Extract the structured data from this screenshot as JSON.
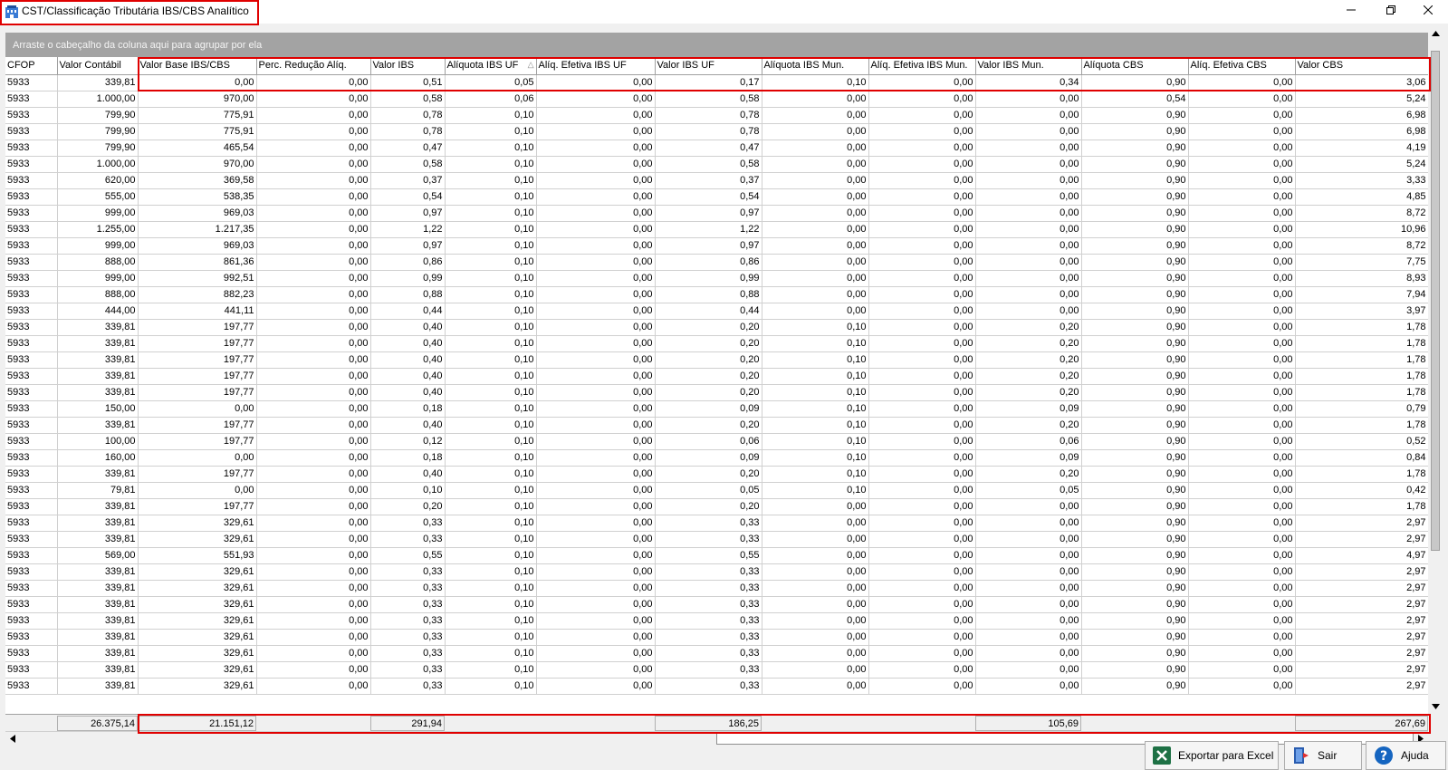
{
  "window": {
    "title": "CST/Classificação Tributária IBS/CBS Analítico"
  },
  "grid": {
    "group_hint": "Arraste o cabeçalho da coluna aqui para agrupar por ela",
    "sort_indicator": "△",
    "columns": [
      "CFOP",
      "Valor Contábil",
      "Valor Base IBS/CBS",
      "Perc. Redução Alíq.",
      "Valor IBS",
      "Alíquota IBS UF",
      "Alíq. Efetiva IBS UF",
      "Valor IBS UF",
      "Alíquota IBS Mun.",
      "Alíq. Efetiva IBS Mun.",
      "Valor IBS Mun.",
      "Alíquota CBS",
      "Alíq. Efetiva CBS",
      "Valor CBS"
    ],
    "rows": [
      [
        "5933",
        "339,81",
        "0,00",
        "0,00",
        "0,51",
        "0,05",
        "0,00",
        "0,17",
        "0,10",
        "0,00",
        "0,34",
        "0,90",
        "0,00",
        "3,06"
      ],
      [
        "5933",
        "1.000,00",
        "970,00",
        "0,00",
        "0,58",
        "0,06",
        "0,00",
        "0,58",
        "0,00",
        "0,00",
        "0,00",
        "0,54",
        "0,00",
        "5,24"
      ],
      [
        "5933",
        "799,90",
        "775,91",
        "0,00",
        "0,78",
        "0,10",
        "0,00",
        "0,78",
        "0,00",
        "0,00",
        "0,00",
        "0,90",
        "0,00",
        "6,98"
      ],
      [
        "5933",
        "799,90",
        "775,91",
        "0,00",
        "0,78",
        "0,10",
        "0,00",
        "0,78",
        "0,00",
        "0,00",
        "0,00",
        "0,90",
        "0,00",
        "6,98"
      ],
      [
        "5933",
        "799,90",
        "465,54",
        "0,00",
        "0,47",
        "0,10",
        "0,00",
        "0,47",
        "0,00",
        "0,00",
        "0,00",
        "0,90",
        "0,00",
        "4,19"
      ],
      [
        "5933",
        "1.000,00",
        "970,00",
        "0,00",
        "0,58",
        "0,10",
        "0,00",
        "0,58",
        "0,00",
        "0,00",
        "0,00",
        "0,90",
        "0,00",
        "5,24"
      ],
      [
        "5933",
        "620,00",
        "369,58",
        "0,00",
        "0,37",
        "0,10",
        "0,00",
        "0,37",
        "0,00",
        "0,00",
        "0,00",
        "0,90",
        "0,00",
        "3,33"
      ],
      [
        "5933",
        "555,00",
        "538,35",
        "0,00",
        "0,54",
        "0,10",
        "0,00",
        "0,54",
        "0,00",
        "0,00",
        "0,00",
        "0,90",
        "0,00",
        "4,85"
      ],
      [
        "5933",
        "999,00",
        "969,03",
        "0,00",
        "0,97",
        "0,10",
        "0,00",
        "0,97",
        "0,00",
        "0,00",
        "0,00",
        "0,90",
        "0,00",
        "8,72"
      ],
      [
        "5933",
        "1.255,00",
        "1.217,35",
        "0,00",
        "1,22",
        "0,10",
        "0,00",
        "1,22",
        "0,00",
        "0,00",
        "0,00",
        "0,90",
        "0,00",
        "10,96"
      ],
      [
        "5933",
        "999,00",
        "969,03",
        "0,00",
        "0,97",
        "0,10",
        "0,00",
        "0,97",
        "0,00",
        "0,00",
        "0,00",
        "0,90",
        "0,00",
        "8,72"
      ],
      [
        "5933",
        "888,00",
        "861,36",
        "0,00",
        "0,86",
        "0,10",
        "0,00",
        "0,86",
        "0,00",
        "0,00",
        "0,00",
        "0,90",
        "0,00",
        "7,75"
      ],
      [
        "5933",
        "999,00",
        "992,51",
        "0,00",
        "0,99",
        "0,10",
        "0,00",
        "0,99",
        "0,00",
        "0,00",
        "0,00",
        "0,90",
        "0,00",
        "8,93"
      ],
      [
        "5933",
        "888,00",
        "882,23",
        "0,00",
        "0,88",
        "0,10",
        "0,00",
        "0,88",
        "0,00",
        "0,00",
        "0,00",
        "0,90",
        "0,00",
        "7,94"
      ],
      [
        "5933",
        "444,00",
        "441,11",
        "0,00",
        "0,44",
        "0,10",
        "0,00",
        "0,44",
        "0,00",
        "0,00",
        "0,00",
        "0,90",
        "0,00",
        "3,97"
      ],
      [
        "5933",
        "339,81",
        "197,77",
        "0,00",
        "0,40",
        "0,10",
        "0,00",
        "0,20",
        "0,10",
        "0,00",
        "0,20",
        "0,90",
        "0,00",
        "1,78"
      ],
      [
        "5933",
        "339,81",
        "197,77",
        "0,00",
        "0,40",
        "0,10",
        "0,00",
        "0,20",
        "0,10",
        "0,00",
        "0,20",
        "0,90",
        "0,00",
        "1,78"
      ],
      [
        "5933",
        "339,81",
        "197,77",
        "0,00",
        "0,40",
        "0,10",
        "0,00",
        "0,20",
        "0,10",
        "0,00",
        "0,20",
        "0,90",
        "0,00",
        "1,78"
      ],
      [
        "5933",
        "339,81",
        "197,77",
        "0,00",
        "0,40",
        "0,10",
        "0,00",
        "0,20",
        "0,10",
        "0,00",
        "0,20",
        "0,90",
        "0,00",
        "1,78"
      ],
      [
        "5933",
        "339,81",
        "197,77",
        "0,00",
        "0,40",
        "0,10",
        "0,00",
        "0,20",
        "0,10",
        "0,00",
        "0,20",
        "0,90",
        "0,00",
        "1,78"
      ],
      [
        "5933",
        "150,00",
        "0,00",
        "0,00",
        "0,18",
        "0,10",
        "0,00",
        "0,09",
        "0,10",
        "0,00",
        "0,09",
        "0,90",
        "0,00",
        "0,79"
      ],
      [
        "5933",
        "339,81",
        "197,77",
        "0,00",
        "0,40",
        "0,10",
        "0,00",
        "0,20",
        "0,10",
        "0,00",
        "0,20",
        "0,90",
        "0,00",
        "1,78"
      ],
      [
        "5933",
        "100,00",
        "197,77",
        "0,00",
        "0,12",
        "0,10",
        "0,00",
        "0,06",
        "0,10",
        "0,00",
        "0,06",
        "0,90",
        "0,00",
        "0,52"
      ],
      [
        "5933",
        "160,00",
        "0,00",
        "0,00",
        "0,18",
        "0,10",
        "0,00",
        "0,09",
        "0,10",
        "0,00",
        "0,09",
        "0,90",
        "0,00",
        "0,84"
      ],
      [
        "5933",
        "339,81",
        "197,77",
        "0,00",
        "0,40",
        "0,10",
        "0,00",
        "0,20",
        "0,10",
        "0,00",
        "0,20",
        "0,90",
        "0,00",
        "1,78"
      ],
      [
        "5933",
        "79,81",
        "0,00",
        "0,00",
        "0,10",
        "0,10",
        "0,00",
        "0,05",
        "0,10",
        "0,00",
        "0,05",
        "0,90",
        "0,00",
        "0,42"
      ],
      [
        "5933",
        "339,81",
        "197,77",
        "0,00",
        "0,20",
        "0,10",
        "0,00",
        "0,20",
        "0,00",
        "0,00",
        "0,00",
        "0,90",
        "0,00",
        "1,78"
      ],
      [
        "5933",
        "339,81",
        "329,61",
        "0,00",
        "0,33",
        "0,10",
        "0,00",
        "0,33",
        "0,00",
        "0,00",
        "0,00",
        "0,90",
        "0,00",
        "2,97"
      ],
      [
        "5933",
        "339,81",
        "329,61",
        "0,00",
        "0,33",
        "0,10",
        "0,00",
        "0,33",
        "0,00",
        "0,00",
        "0,00",
        "0,90",
        "0,00",
        "2,97"
      ],
      [
        "5933",
        "569,00",
        "551,93",
        "0,00",
        "0,55",
        "0,10",
        "0,00",
        "0,55",
        "0,00",
        "0,00",
        "0,00",
        "0,90",
        "0,00",
        "4,97"
      ],
      [
        "5933",
        "339,81",
        "329,61",
        "0,00",
        "0,33",
        "0,10",
        "0,00",
        "0,33",
        "0,00",
        "0,00",
        "0,00",
        "0,90",
        "0,00",
        "2,97"
      ],
      [
        "5933",
        "339,81",
        "329,61",
        "0,00",
        "0,33",
        "0,10",
        "0,00",
        "0,33",
        "0,00",
        "0,00",
        "0,00",
        "0,90",
        "0,00",
        "2,97"
      ],
      [
        "5933",
        "339,81",
        "329,61",
        "0,00",
        "0,33",
        "0,10",
        "0,00",
        "0,33",
        "0,00",
        "0,00",
        "0,00",
        "0,90",
        "0,00",
        "2,97"
      ],
      [
        "5933",
        "339,81",
        "329,61",
        "0,00",
        "0,33",
        "0,10",
        "0,00",
        "0,33",
        "0,00",
        "0,00",
        "0,00",
        "0,90",
        "0,00",
        "2,97"
      ],
      [
        "5933",
        "339,81",
        "329,61",
        "0,00",
        "0,33",
        "0,10",
        "0,00",
        "0,33",
        "0,00",
        "0,00",
        "0,00",
        "0,90",
        "0,00",
        "2,97"
      ],
      [
        "5933",
        "339,81",
        "329,61",
        "0,00",
        "0,33",
        "0,10",
        "0,00",
        "0,33",
        "0,00",
        "0,00",
        "0,00",
        "0,90",
        "0,00",
        "2,97"
      ],
      [
        "5933",
        "339,81",
        "329,61",
        "0,00",
        "0,33",
        "0,10",
        "0,00",
        "0,33",
        "0,00",
        "0,00",
        "0,00",
        "0,90",
        "0,00",
        "2,97"
      ],
      [
        "5933",
        "339,81",
        "329,61",
        "0,00",
        "0,33",
        "0,10",
        "0,00",
        "0,33",
        "0,00",
        "0,00",
        "0,00",
        "0,90",
        "0,00",
        "2,97"
      ]
    ],
    "totals": {
      "valor_contabil": "26.375,14",
      "valor_base": "21.151,12",
      "valor_ibs": "291,94",
      "valor_ibs_uf": "186,25",
      "valor_ibs_mun": "105,69",
      "valor_cbs": "267,69"
    }
  },
  "buttons": {
    "export": "Exportar para Excel",
    "exit": "Sair",
    "help": "Ajuda"
  },
  "icons": {
    "app": "app-building-icon",
    "minimize": "minimize-icon",
    "restore": "restore-icon",
    "close": "close-icon",
    "excel": "excel-icon",
    "exit": "exit-door-icon",
    "help": "help-question-icon"
  },
  "colors": {
    "highlight": "#e00000",
    "group_bar": "#a3a3a3",
    "excel_green": "#1e7145",
    "help_blue": "#1565c0"
  }
}
